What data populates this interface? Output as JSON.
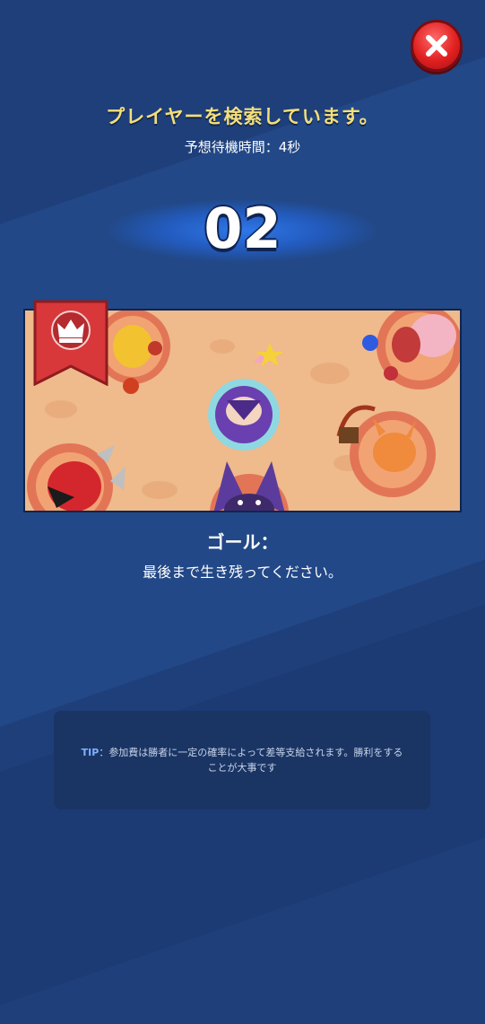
{
  "header": {
    "title": "プレイヤーを検索しています。",
    "wait_text": "予想待機時間：4秒",
    "countdown": "02"
  },
  "close_button": {
    "icon": "close-icon"
  },
  "mode": {
    "banner_icon": "crown-icon",
    "goal_label": "ゴール：",
    "goal_text": "最後まで生き残ってください。"
  },
  "tip": {
    "key": "TIP",
    "separator": "：",
    "text": "参加費は勝者に一定の確率によって差等支給されます。勝利をすることが大事です"
  },
  "colors": {
    "background": "#1f3f7a",
    "title": "#f4df7a",
    "close": "#e02020",
    "banner": "#d8383a",
    "arena": "#efba8c",
    "tip_box": "#1a3564"
  }
}
